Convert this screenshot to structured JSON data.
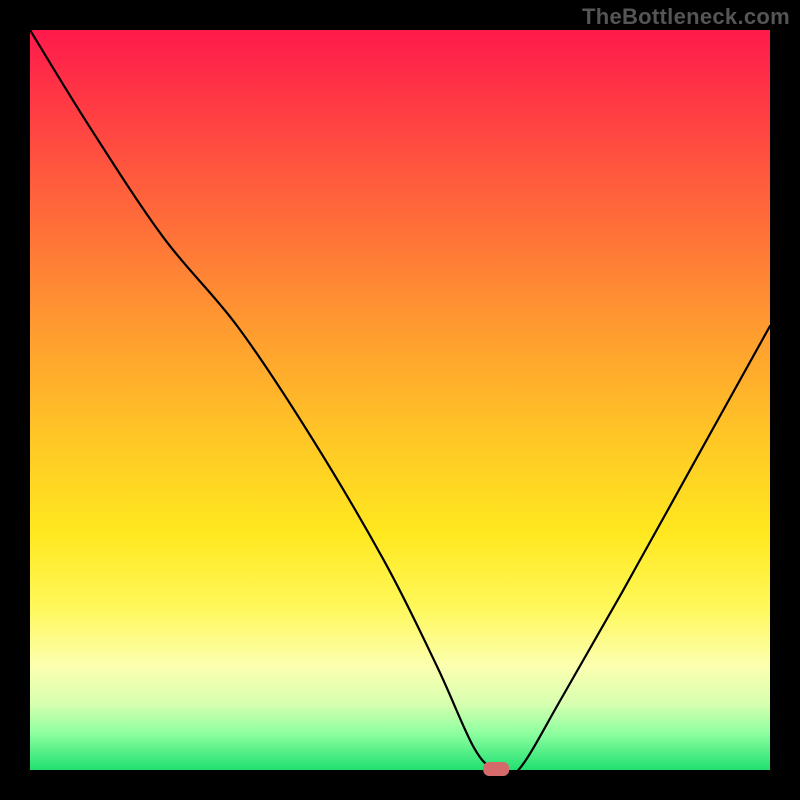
{
  "watermark": "TheBottleneck.com",
  "chart_data": {
    "type": "line",
    "title": "",
    "xlabel": "",
    "ylabel": "",
    "xlim": [
      0,
      100
    ],
    "ylim": [
      0,
      100
    ],
    "grid": false,
    "legend": false,
    "marker": {
      "x": 63,
      "y": 0,
      "color": "#d46a6a"
    },
    "series": [
      {
        "name": "curve",
        "x": [
          0,
          8,
          18,
          28,
          38,
          48,
          55,
          60,
          63,
          66,
          72,
          80,
          90,
          100
        ],
        "y": [
          100,
          87,
          72,
          60,
          45,
          28,
          14,
          3,
          0,
          0,
          10,
          24,
          42,
          60
        ]
      }
    ],
    "gradient_stops": [
      {
        "pos": 0.0,
        "color": "#ff1a4c"
      },
      {
        "pos": 0.25,
        "color": "#ff6a3a"
      },
      {
        "pos": 0.55,
        "color": "#ffc626"
      },
      {
        "pos": 0.78,
        "color": "#fff85a"
      },
      {
        "pos": 0.91,
        "color": "#d8ffb0"
      },
      {
        "pos": 1.0,
        "color": "#20e070"
      }
    ]
  }
}
